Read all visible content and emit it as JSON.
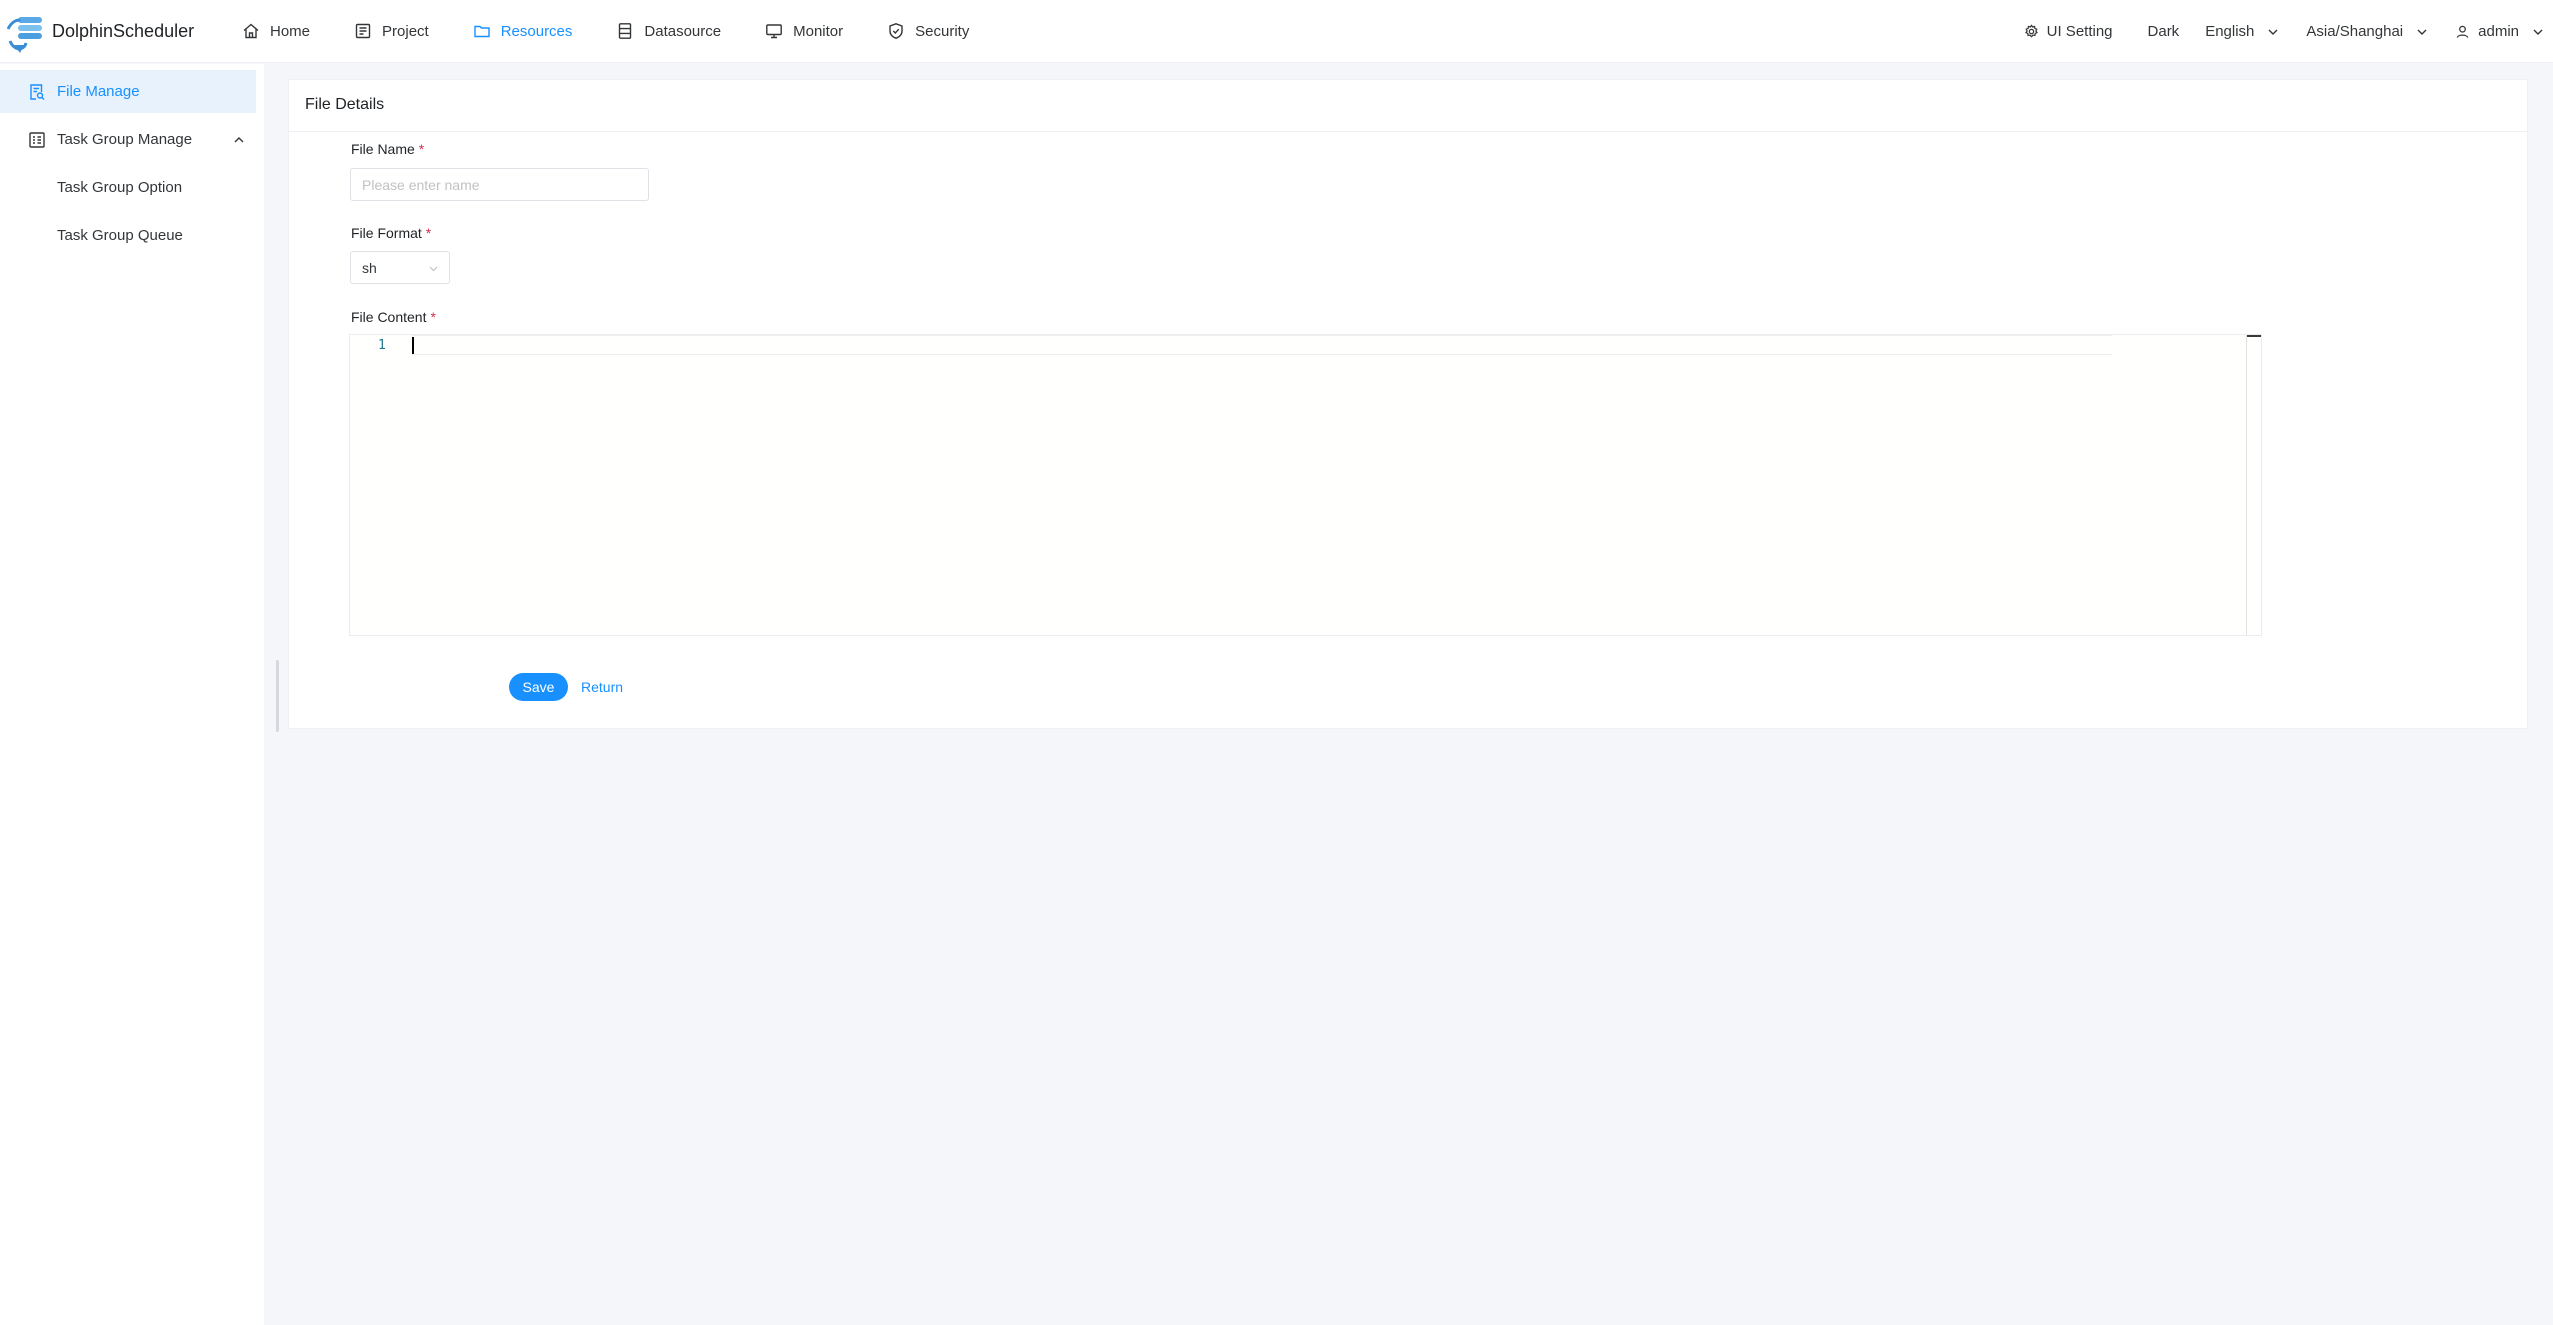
{
  "app": {
    "title": "DolphinScheduler"
  },
  "topnav": {
    "items": [
      {
        "label": "Home",
        "icon": "home-icon"
      },
      {
        "label": "Project",
        "icon": "project-icon"
      },
      {
        "label": "Resources",
        "icon": "folder-icon",
        "active": true
      },
      {
        "label": "Datasource",
        "icon": "database-icon"
      },
      {
        "label": "Monitor",
        "icon": "monitor-icon"
      },
      {
        "label": "Security",
        "icon": "shield-icon"
      }
    ],
    "right": {
      "ui_setting": "UI Setting",
      "theme": "Dark",
      "language": "English",
      "timezone": "Asia/Shanghai",
      "user": "admin"
    }
  },
  "sidebar": {
    "items": [
      {
        "label": "File Manage",
        "icon": "file-search-icon",
        "active": true
      },
      {
        "label": "Task Group Manage",
        "icon": "task-group-icon",
        "expanded": true
      },
      {
        "label": "Task Group Option"
      },
      {
        "label": "Task Group Queue"
      }
    ]
  },
  "form": {
    "title": "File Details",
    "file_name": {
      "label": "File Name",
      "required_mark": "*",
      "value": "",
      "placeholder": "Please enter name"
    },
    "file_format": {
      "label": "File Format",
      "required_mark": "*",
      "value": "sh"
    },
    "file_content": {
      "label": "File Content",
      "required_mark": "*",
      "line_numbers": [
        "1"
      ],
      "content": ""
    },
    "save_label": "Save",
    "return_label": "Return"
  },
  "colors": {
    "accent": "#1890ff",
    "required": "#d03050",
    "background": "#f5f6fa"
  }
}
